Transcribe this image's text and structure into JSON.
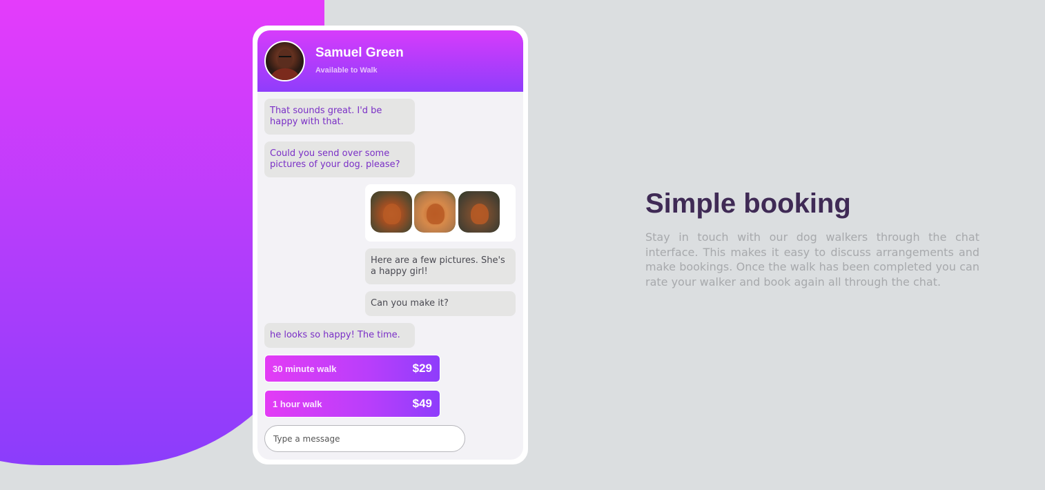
{
  "chat": {
    "contact_name": "Samuel Green",
    "contact_status": "Available to Walk",
    "messages": [
      {
        "from": "walker",
        "text": "That sounds great. I'd be happy with that."
      },
      {
        "from": "walker",
        "text": "Could you send over some pictures of your dog. please?"
      },
      {
        "from": "owner",
        "text": "Here are a few pictures. She's a happy girl!"
      },
      {
        "from": "owner",
        "text": "Can you make it?"
      },
      {
        "from": "walker",
        "text": "he looks so happy! The time."
      }
    ],
    "photos": [
      "dog-photo-1",
      "dog-photo-2",
      "dog-photo-3"
    ],
    "offers": [
      {
        "label": "30 minute walk",
        "price": "$29"
      },
      {
        "label": "1 hour walk",
        "price": "$49"
      }
    ],
    "input_placeholder": "Type a message"
  },
  "feature": {
    "title": "Simple booking",
    "description": "Stay in touch with our dog walkers through the chat interface. This makes it easy to discuss arrangements and make bookings. Once the walk has been completed you can rate your walker and book again all through the chat."
  },
  "colors": {
    "gradient_top": "#e63cfb",
    "gradient_bottom": "#8c3dfb",
    "title": "#3f2a55",
    "walker_text": "#7a2fc6",
    "background": "#dbdee0"
  }
}
